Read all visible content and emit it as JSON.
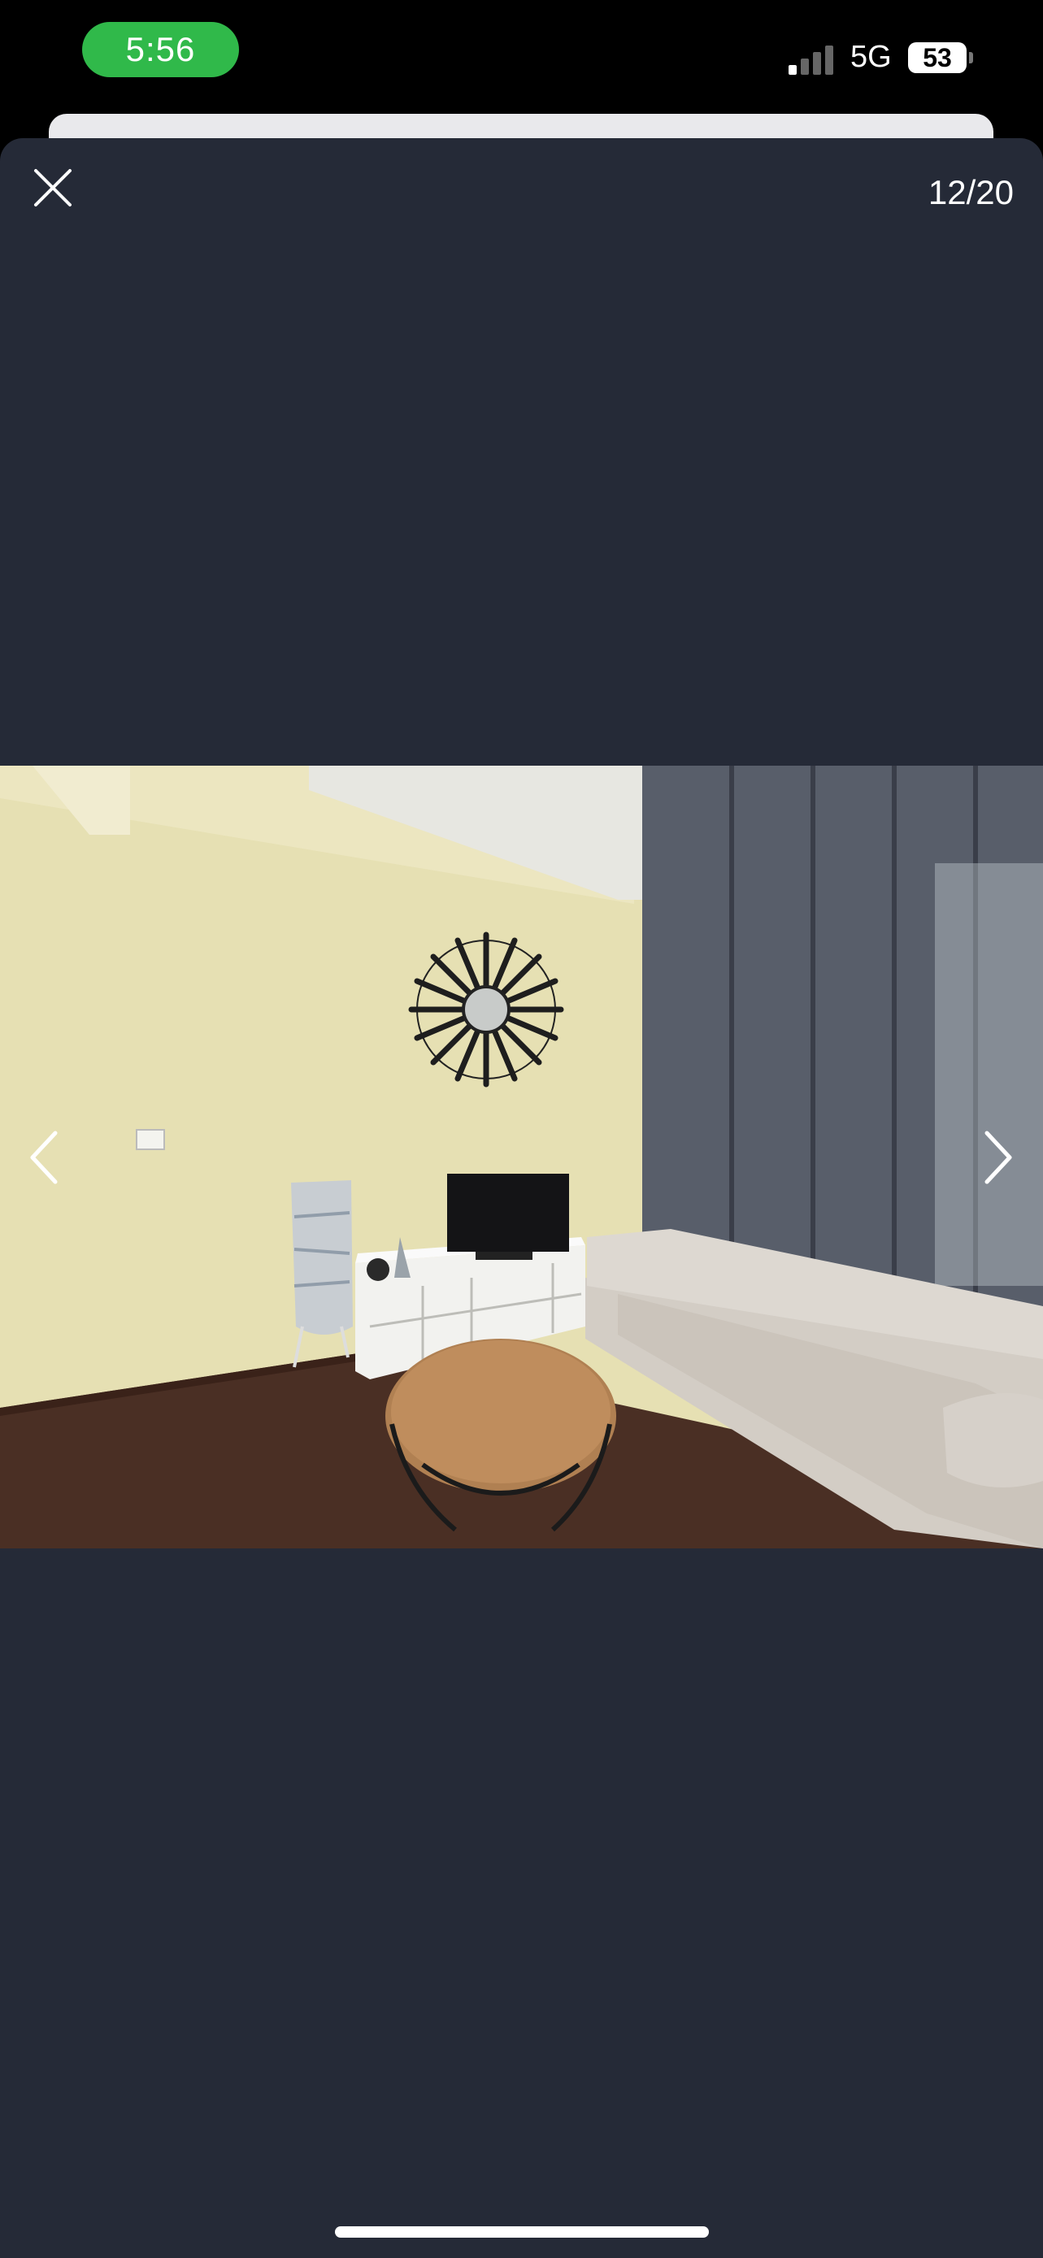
{
  "status_bar": {
    "time": "5:56",
    "network": "5G",
    "battery": "53",
    "icons": [
      "signal-icon",
      "battery-icon"
    ]
  },
  "viewer": {
    "counter": "12/20",
    "icons": [
      "close-icon",
      "chevron-left-icon",
      "chevron-right-icon"
    ],
    "photo_description_label": "living-room-photo"
  },
  "colors": {
    "time_pill": "#30b94a",
    "viewer_background": "#252a37",
    "status_background": "#000000"
  }
}
